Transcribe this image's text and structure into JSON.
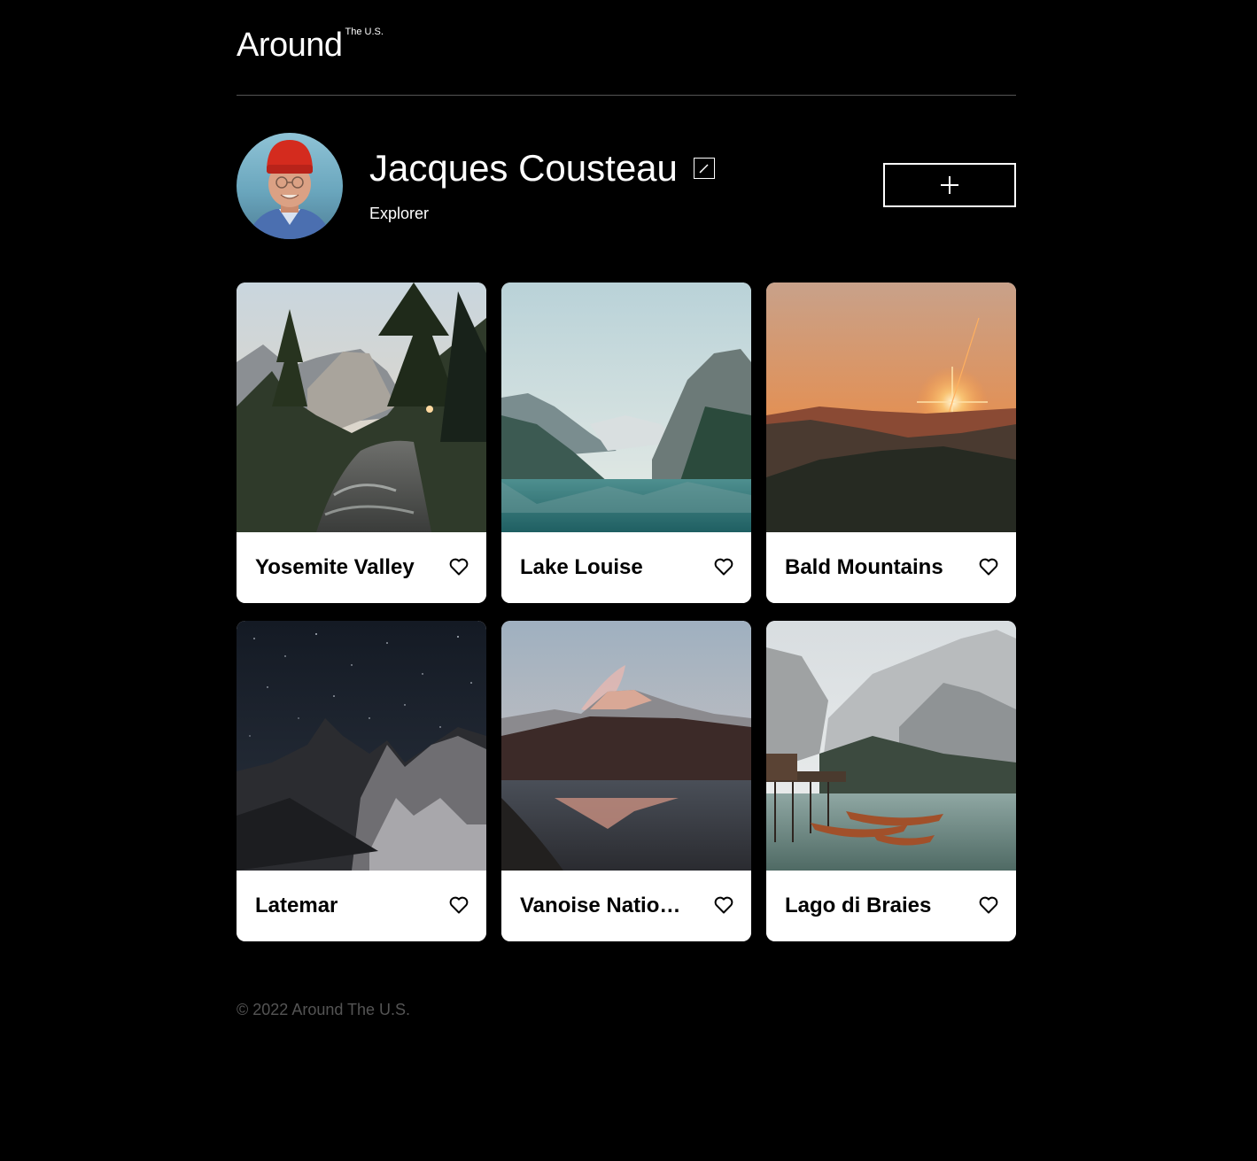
{
  "header": {
    "logo_main": "Around",
    "logo_sup": "The U.S."
  },
  "profile": {
    "name": "Jacques Cousteau",
    "about": "Explorer",
    "edit_icon": "pencil-icon",
    "add_icon": "plus-icon"
  },
  "cards": [
    {
      "title": "Yosemite Valley",
      "like_icon": "heart-outline-icon"
    },
    {
      "title": "Lake Louise",
      "like_icon": "heart-outline-icon"
    },
    {
      "title": "Bald Mountains",
      "like_icon": "heart-outline-icon"
    },
    {
      "title": "Latemar",
      "like_icon": "heart-outline-icon"
    },
    {
      "title": "Vanoise National Park",
      "like_icon": "heart-outline-icon"
    },
    {
      "title": "Lago di Braies",
      "like_icon": "heart-outline-icon"
    }
  ],
  "footer": {
    "copyright": "© 2022 Around The U.S."
  },
  "colors": {
    "background": "#000000",
    "card": "#ffffff",
    "footer_text": "#545454",
    "divider": "#545454"
  }
}
